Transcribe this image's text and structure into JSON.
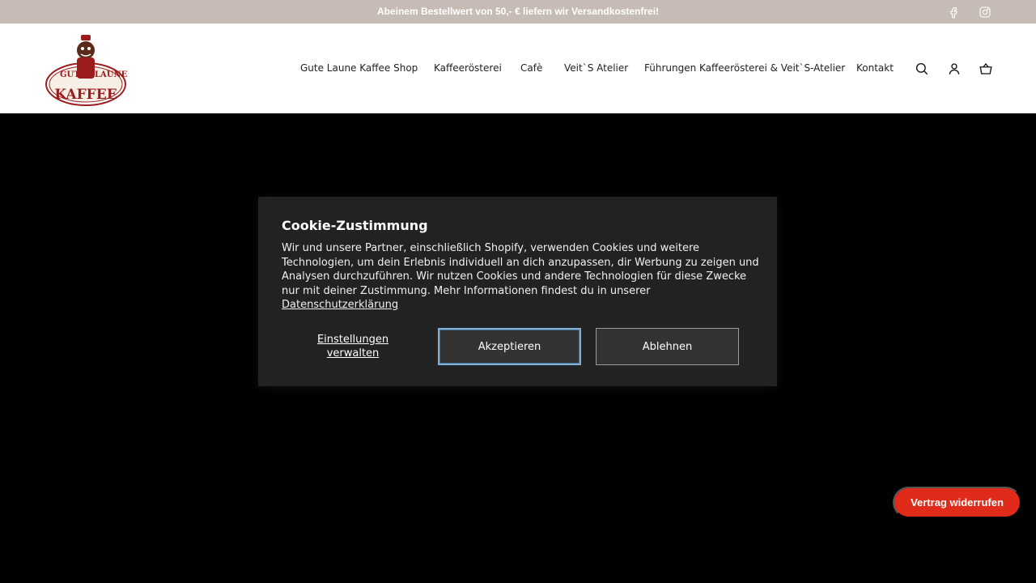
{
  "announcement": {
    "text": "Abeinem Bestellwert von 50,- € liefern wir Versandkostenfrei!",
    "social_icons": [
      "facebook-icon",
      "instagram-icon"
    ]
  },
  "header": {
    "logo": {
      "line1": "GUTE",
      "line2": "LAUNE",
      "line3": "KAFFEE"
    },
    "nav": [
      "Gute Laune Kaffee Shop",
      "Kaffeerösterei",
      "Cafè",
      "Veit`S Atelier",
      "Führungen Kaffeerösterei & Veit`S-Atelier",
      "Kontakt"
    ],
    "icons": [
      "search-icon",
      "account-icon",
      "cart-icon"
    ]
  },
  "cookie": {
    "title": "Cookie-Zustimmung",
    "body": "Wir und unsere Partner, einschließlich Shopify, verwenden Cookies und weitere Technologien, um dein Erlebnis individuell an dich anzupassen, dir Werbung zu zeigen und Analysen durchzuführen. Wir nutzen Cookies und andere Technologien für diese Zwecke nur mit deiner Zustimmung. Mehr Informationen findest du in unserer",
    "privacy_link": "Datenschutzerklärung",
    "manage_label": "Einstellungen verwalten",
    "accept_label": "Akzeptieren",
    "decline_label": "Ablehnen"
  },
  "withdraw_button": "Vertrag widerrufen",
  "colors": {
    "announcement_bg": "#c7bcb5",
    "dialog_bg": "#222222",
    "withdraw_bg": "#e02b1a",
    "logo_red": "#9b1c1c"
  }
}
